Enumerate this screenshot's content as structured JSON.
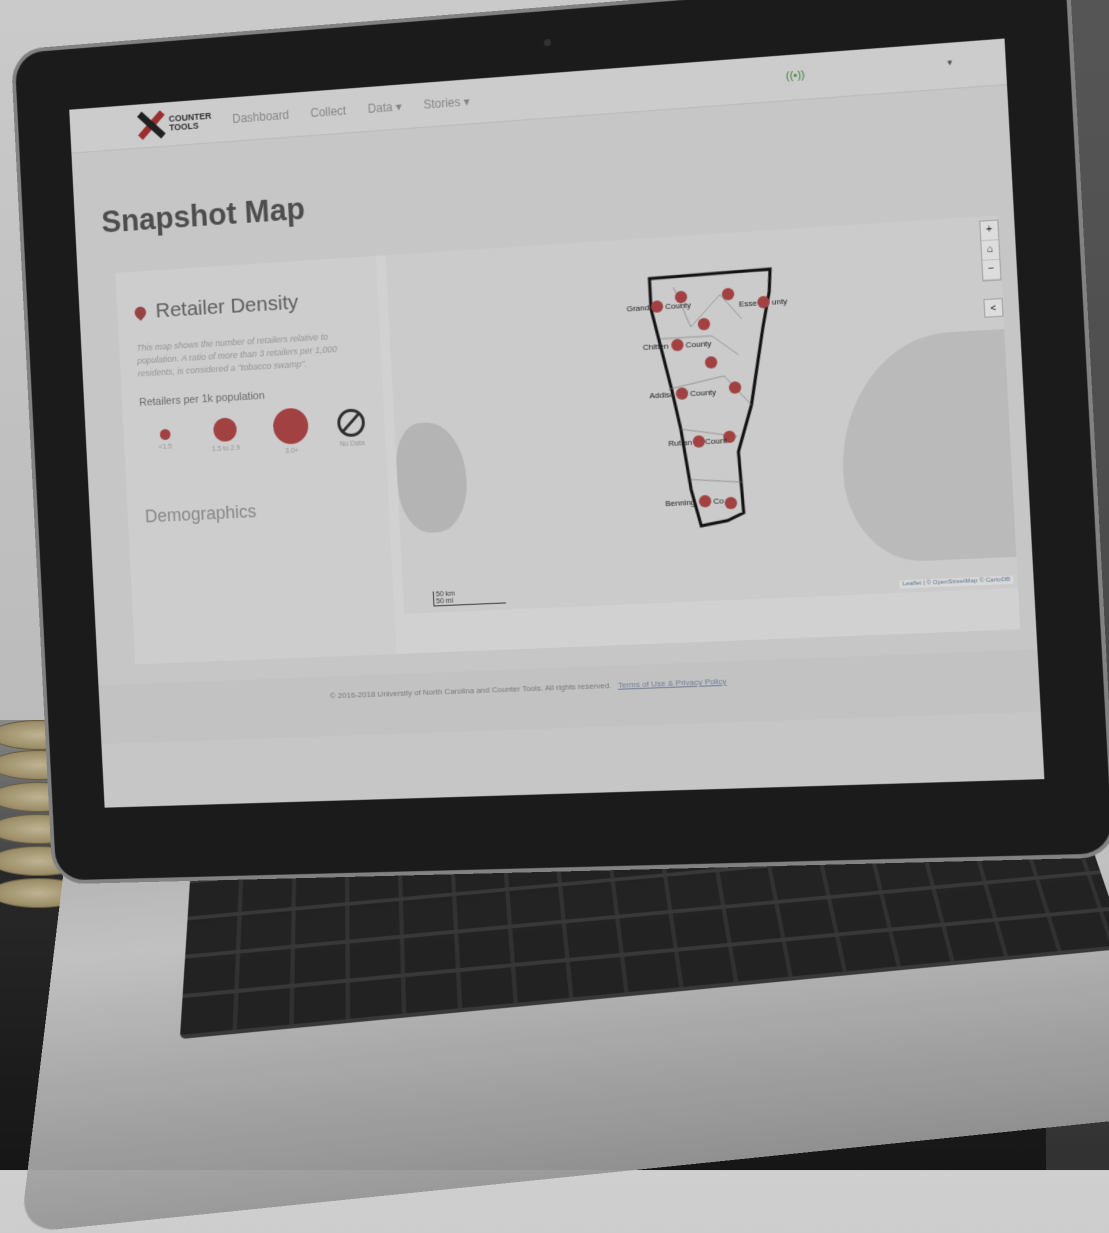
{
  "app": {
    "logo_text": "COUNTER TOOLS"
  },
  "nav": {
    "items": [
      {
        "label": "Dashboard"
      },
      {
        "label": "Collect"
      },
      {
        "label": "Data ▾"
      },
      {
        "label": "Stories ▾"
      }
    ],
    "signal_icon": "signal-icon",
    "caret": "▾"
  },
  "page": {
    "title": "Snapshot Map"
  },
  "sidebar": {
    "title": "Retailer Density",
    "description": "This map shows the number of retailers relative to population. A ratio of more than 3 retailers per 1,000 residents, is considered a \"tobacco swamp\".",
    "legend_title": "Retailers per 1k population",
    "legend": [
      {
        "label": "<1.5"
      },
      {
        "label": "1.5 to 2.9"
      },
      {
        "label": "3.0+"
      },
      {
        "label": "No Data"
      }
    ],
    "demographics": "Demographics"
  },
  "map": {
    "zoom_in": "+",
    "home": "⌂",
    "zoom_out": "−",
    "share": "<",
    "attribution": "Leaflet | © OpenStreetMap © CartoDB",
    "scale_km": "50 km",
    "scale_mi": "50 mi",
    "labels": {
      "grand": "Grand",
      "county1": "County",
      "essex": "Esse",
      "essex_suffix": "unty",
      "chittenden": "Chitten",
      "county2": "County",
      "addison": "Addiso",
      "county3": "County",
      "rutland": "Rutlan",
      "county4": "Count",
      "benning": "Benning",
      "county5": "Co"
    },
    "dot_color": "#c84545"
  },
  "footer": {
    "copyright": "© 2016-2018 University of North Carolina and Counter Tools. All rights reserved.",
    "terms": "Terms of Use & Privacy Policy"
  }
}
